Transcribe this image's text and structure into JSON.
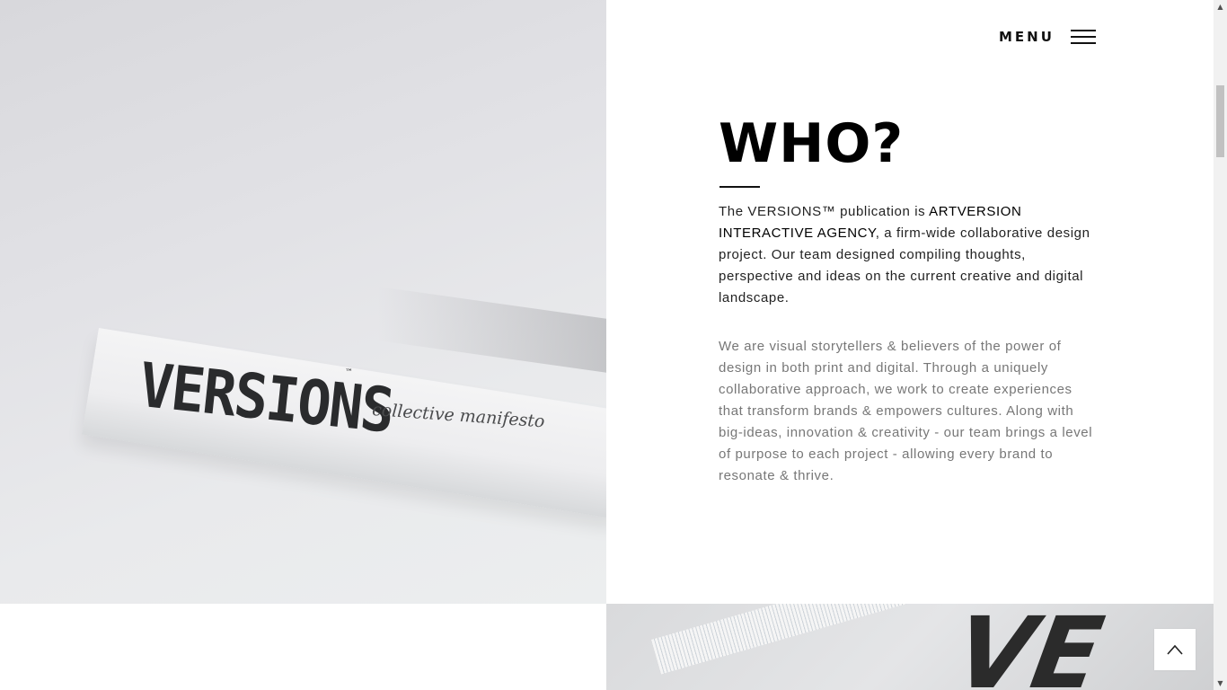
{
  "header": {
    "menu_label": "MENU"
  },
  "hero_image": {
    "book_title": "VERSIONS",
    "book_tm": "™",
    "book_subtitle": "collective manifesto"
  },
  "about": {
    "title": "WHO?",
    "intro_lead": "The VERSIONS™ publication is ",
    "intro_agency": "ARTVERSION INTERACTIVE AGENCY",
    "intro_rest": ", a firm-wide collaborative design project. Our team designed compiling thoughts, perspective and ideas on the current creative and digital landscape.",
    "body": "We are visual storytellers & believers of the power of design in both print and digital. Through a uniquely collaborative approach, we work to create experiences that transform brands & empowers cultures. Along with big-ideas, innovation & creativity - our team brings a level of purpose to each project - allowing every brand to resonate & thrive."
  },
  "second_image": {
    "visible_letters": "VE"
  },
  "controls": {
    "back_to_top_icon": "chevron-up-icon",
    "scroll_up_glyph": "▲",
    "scroll_down_glyph": "▼"
  }
}
